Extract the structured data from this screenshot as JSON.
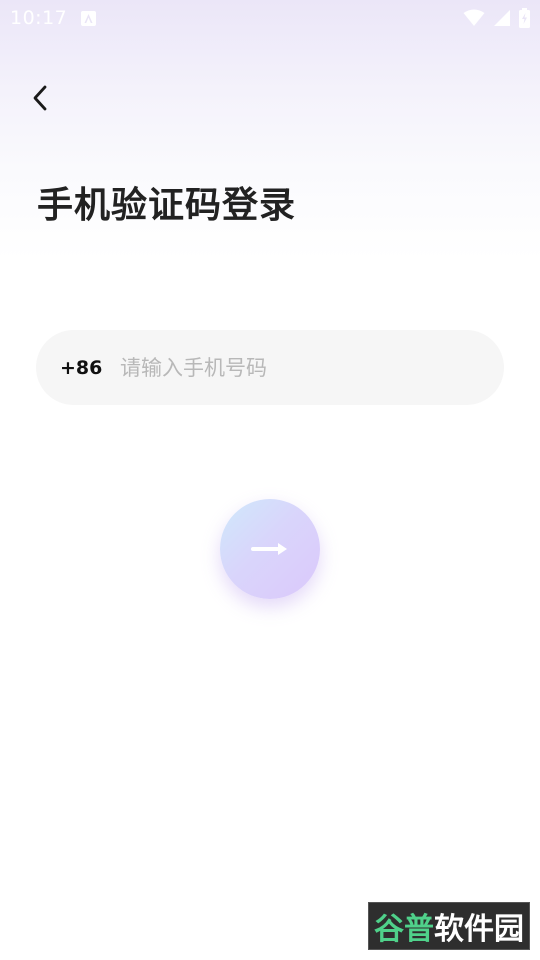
{
  "status_bar": {
    "time": "10:17",
    "icons": [
      "notification-a-icon",
      "wifi-icon",
      "signal-icon",
      "battery-charging-icon"
    ]
  },
  "header": {
    "back_icon": "chevron-left-icon",
    "title": "手机验证码登录"
  },
  "phone_input": {
    "country_code": "+86",
    "placeholder": "请输入手机号码",
    "value": ""
  },
  "next_button": {
    "icon": "arrow-right-icon"
  },
  "watermark": {
    "green_text": "谷普",
    "white_text": "软件园"
  },
  "colors": {
    "title": "#222222",
    "input_bg": "#f6f6f6",
    "placeholder": "#b8b8b8",
    "button_gradient_start": "#cfe9fb",
    "button_gradient_end": "#dbc8fb"
  }
}
